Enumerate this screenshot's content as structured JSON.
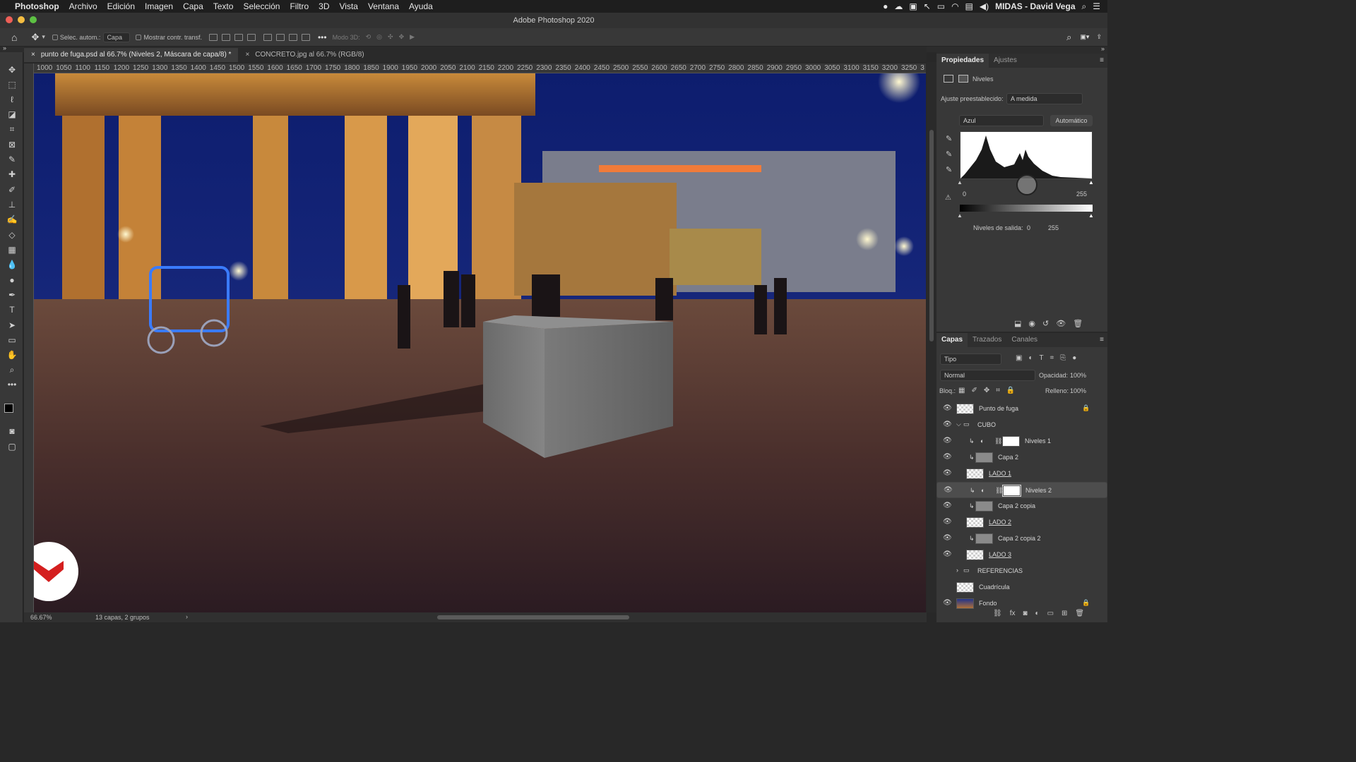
{
  "menubar": {
    "app": "Photoshop",
    "items": [
      "Archivo",
      "Edición",
      "Imagen",
      "Capa",
      "Texto",
      "Selección",
      "Filtro",
      "3D",
      "Vista",
      "Ventana",
      "Ayuda"
    ],
    "user": "MIDAS - David Vega"
  },
  "window": {
    "title": "Adobe Photoshop 2020"
  },
  "options": {
    "autoselect": "Selec. autom.:",
    "autoselect_value": "Capa",
    "show_transform": "Mostrar contr. transf.",
    "mode3d": "Modo 3D:"
  },
  "tabs": [
    {
      "label": "punto de fuga.psd al 66.7% (Niveles 2, Máscara de capa/8) *"
    },
    {
      "label": "CONCRETO.jpg al 66.7% (RGB/8)"
    }
  ],
  "ruler": [
    "1000",
    "1050",
    "1100",
    "1150",
    "1200",
    "1250",
    "1300",
    "1350",
    "1400",
    "1450",
    "1500",
    "1550",
    "1600",
    "1650",
    "1700",
    "1750",
    "1800",
    "1850",
    "1900",
    "1950",
    "2000",
    "2050",
    "2100",
    "2150",
    "2200",
    "2250",
    "2300",
    "2350",
    "2400",
    "2450",
    "2500",
    "2550",
    "2600",
    "2650",
    "2700",
    "2750",
    "2800",
    "2850",
    "2900",
    "2950",
    "3000",
    "3050",
    "3100",
    "3150",
    "3200",
    "3250",
    "3"
  ],
  "status": {
    "zoom": "66.67%",
    "info": "13 capas, 2 grupos"
  },
  "properties": {
    "tab_active": "Propiedades",
    "tab_other": "Ajustes",
    "type": "Niveles",
    "preset_label": "Ajuste preestablecido:",
    "preset_value": "A medida",
    "channel": "Azul",
    "auto": "Automático",
    "input_min": "0",
    "input_max": "255",
    "output_label": "Niveles de salida:",
    "output_min": "0",
    "output_max": "255"
  },
  "layers_panel": {
    "tabs": [
      "Capas",
      "Trazados",
      "Canales"
    ],
    "filter": "Tipo",
    "blend": "Normal",
    "opacity_label": "Opacidad:",
    "opacity": "100%",
    "lock_label": "Bloq.:",
    "fill_label": "Relleno:",
    "fill": "100%",
    "layers": [
      {
        "name": "Punto de fuga"
      },
      {
        "name": "CUBO"
      },
      {
        "name": "Niveles 1"
      },
      {
        "name": "Capa 2"
      },
      {
        "name": "LADO 1"
      },
      {
        "name": "Niveles 2"
      },
      {
        "name": "Capa 2 copia"
      },
      {
        "name": "LADO 2"
      },
      {
        "name": "Capa 2 copia 2"
      },
      {
        "name": "LADO 3"
      },
      {
        "name": "REFERENCIAS"
      },
      {
        "name": "Cuadrícula"
      },
      {
        "name": "Fondo"
      }
    ]
  }
}
